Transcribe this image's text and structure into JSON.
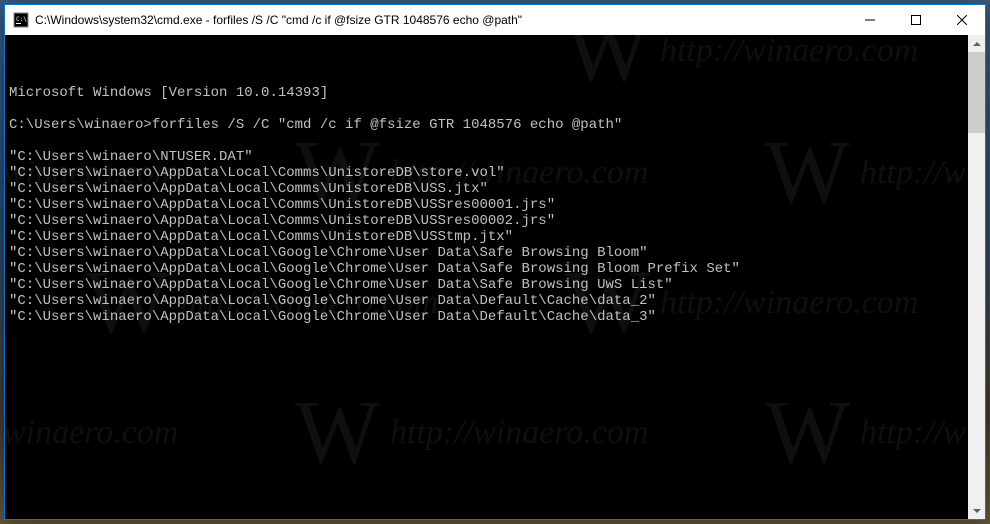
{
  "titlebar": {
    "title": "C:\\Windows\\system32\\cmd.exe - forfiles  /S /C \"cmd /c if @fsize GTR 1048576 echo @path\""
  },
  "console": {
    "lines": [
      "Microsoft Windows [Version 10.0.14393]",
      "",
      "C:\\Users\\winaero>forfiles /S /C \"cmd /c if @fsize GTR 1048576 echo @path\"",
      "",
      "\"C:\\Users\\winaero\\NTUSER.DAT\"",
      "\"C:\\Users\\winaero\\AppData\\Local\\Comms\\UnistoreDB\\store.vol\"",
      "\"C:\\Users\\winaero\\AppData\\Local\\Comms\\UnistoreDB\\USS.jtx\"",
      "\"C:\\Users\\winaero\\AppData\\Local\\Comms\\UnistoreDB\\USSres00001.jrs\"",
      "\"C:\\Users\\winaero\\AppData\\Local\\Comms\\UnistoreDB\\USSres00002.jrs\"",
      "\"C:\\Users\\winaero\\AppData\\Local\\Comms\\UnistoreDB\\USStmp.jtx\"",
      "\"C:\\Users\\winaero\\AppData\\Local\\Google\\Chrome\\User Data\\Safe Browsing Bloom\"",
      "\"C:\\Users\\winaero\\AppData\\Local\\Google\\Chrome\\User Data\\Safe Browsing Bloom Prefix Set\"",
      "\"C:\\Users\\winaero\\AppData\\Local\\Google\\Chrome\\User Data\\Safe Browsing UwS List\"",
      "\"C:\\Users\\winaero\\AppData\\Local\\Google\\Chrome\\User Data\\Default\\Cache\\data_2\"",
      "\"C:\\Users\\winaero\\AppData\\Local\\Google\\Chrome\\User Data\\Default\\Cache\\data_3\""
    ]
  },
  "watermark": {
    "text": "http://winaero.com",
    "logo": "W"
  }
}
